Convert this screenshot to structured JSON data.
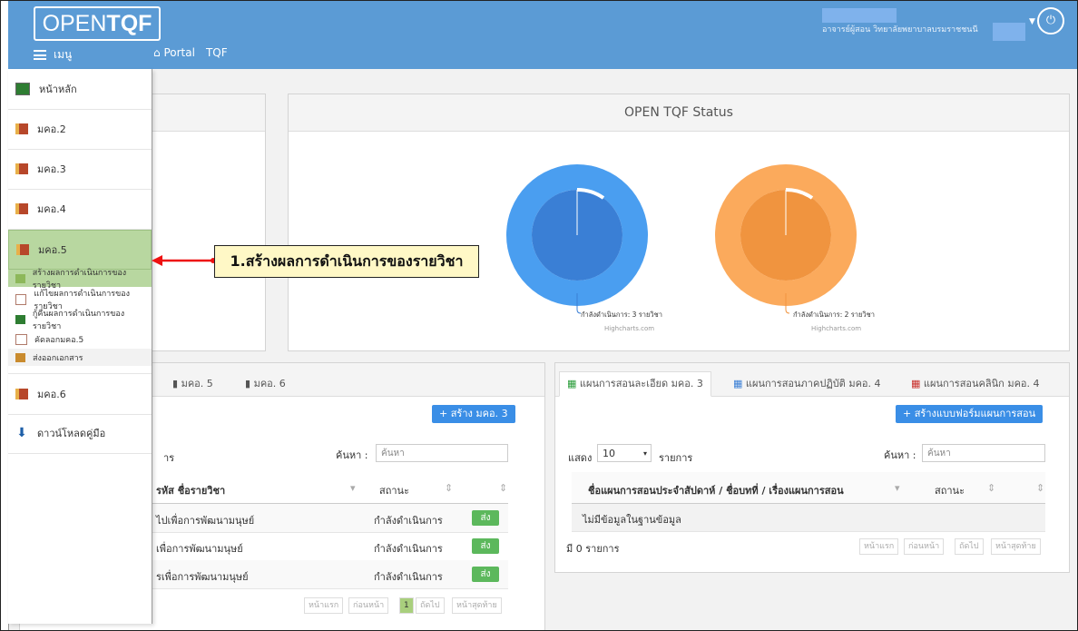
{
  "header": {
    "logo_light": "OPEN",
    "logo_bold": "TQF",
    "menu_label": "เมนู",
    "links": [
      "Portal",
      "TQF"
    ],
    "user_text": "อาจารย์ผู้สอน วิทยาลัยพยาบาลบรมราชชนนี",
    "colors": {
      "bar": "#5b9bd5"
    }
  },
  "menu": {
    "items": [
      {
        "label": "หน้าหลัก",
        "icon": "monitor-icon"
      },
      {
        "label": "มคอ.2",
        "icon": "book-icon"
      },
      {
        "label": "มคอ.3",
        "icon": "book-icon"
      },
      {
        "label": "มคอ.4",
        "icon": "book-icon"
      },
      {
        "label": "มคอ.5",
        "icon": "book-icon"
      },
      {
        "label": "มคอ.6",
        "icon": "book-icon"
      },
      {
        "label": "ดาวน์โหลดคู่มือ",
        "icon": "download-icon"
      }
    ],
    "sub_items": [
      {
        "label": "สร้างผลการดำเนินการของรายวิชา",
        "icon": "book-open-icon"
      },
      {
        "label": "แก้ไขผลการดำเนินการของรายวิชา",
        "icon": "edit-icon"
      },
      {
        "label": "กู้คืนผลการดำเนินการของรายวิชา",
        "icon": "monitor-icon"
      },
      {
        "label": "คัดลอกมคอ.5",
        "icon": "copy-icon"
      },
      {
        "label": "ส่งออกเอกสาร",
        "icon": "export-icon"
      }
    ]
  },
  "callout": {
    "text": "1.สร้างผลการดำเนินการของรายวิชา"
  },
  "status": {
    "title": "OPEN TQF Status",
    "charts": [
      {
        "label": "กำลังดำเนินการ: 3 รายวิชา",
        "credit": "Highcharts.com",
        "color": "#3a7fd5",
        "outer": "#4a9ef0"
      },
      {
        "label": "กำลังดำเนินการ: 2 รายวิชา",
        "credit": "Highcharts.com",
        "color": "#f0943f",
        "outer": "#fbaa5c"
      }
    ]
  },
  "left_table": {
    "tabs": [
      "มคอ. 5",
      "มคอ. 6"
    ],
    "create_btn": "+ สร้าง มคอ. 3",
    "entries_suffix": "าร",
    "search_label": "ค้นหา :",
    "search_placeholder": "ค้นหา",
    "headers": [
      "รหัส ชื่อรายวิชา",
      "สถานะ"
    ],
    "rows": [
      {
        "name": "ไปเพื่อการพัฒนามนุษย์",
        "status": "กำลังดำเนินการ",
        "action": "ส่ง"
      },
      {
        "name": "เพื่อการพัฒนามนุษย์",
        "status": "กำลังดำเนินการ",
        "action": "ส่ง"
      },
      {
        "name": "รเพื่อการพัฒนามนุษย์",
        "status": "กำลังดำเนินการ",
        "action": "ส่ง"
      }
    ],
    "pager": [
      "หน้าแรก",
      "ก่อนหน้า",
      "1",
      "ถัดไป",
      "หน้าสุดท้าย"
    ]
  },
  "right_table": {
    "tabs": [
      "แผนการสอนละเอียด มคอ. 3",
      "แผนการสอนภาคปฏิบัติ มคอ. 4",
      "แผนการสอนคลินิก มคอ. 4"
    ],
    "create_btn": "+ สร้างแบบฟอร์มแผนการสอน",
    "show_label": "แสดง",
    "page_size": "10",
    "entries_label": "รายการ",
    "search_label": "ค้นหา :",
    "search_placeholder": "ค้นหา",
    "headers": [
      "ชื่อแผนการสอนประจำสัปดาห์ / ชื่อบทที่ / เรื่องแผนการสอน",
      "สถานะ"
    ],
    "empty": "ไม่มีข้อมูลในฐานข้อมูล",
    "count": "มี 0 รายการ",
    "pager": [
      "หน้าแรก",
      "ก่อนหน้า",
      "ถัดไป",
      "หน้าสุดท้าย"
    ]
  }
}
